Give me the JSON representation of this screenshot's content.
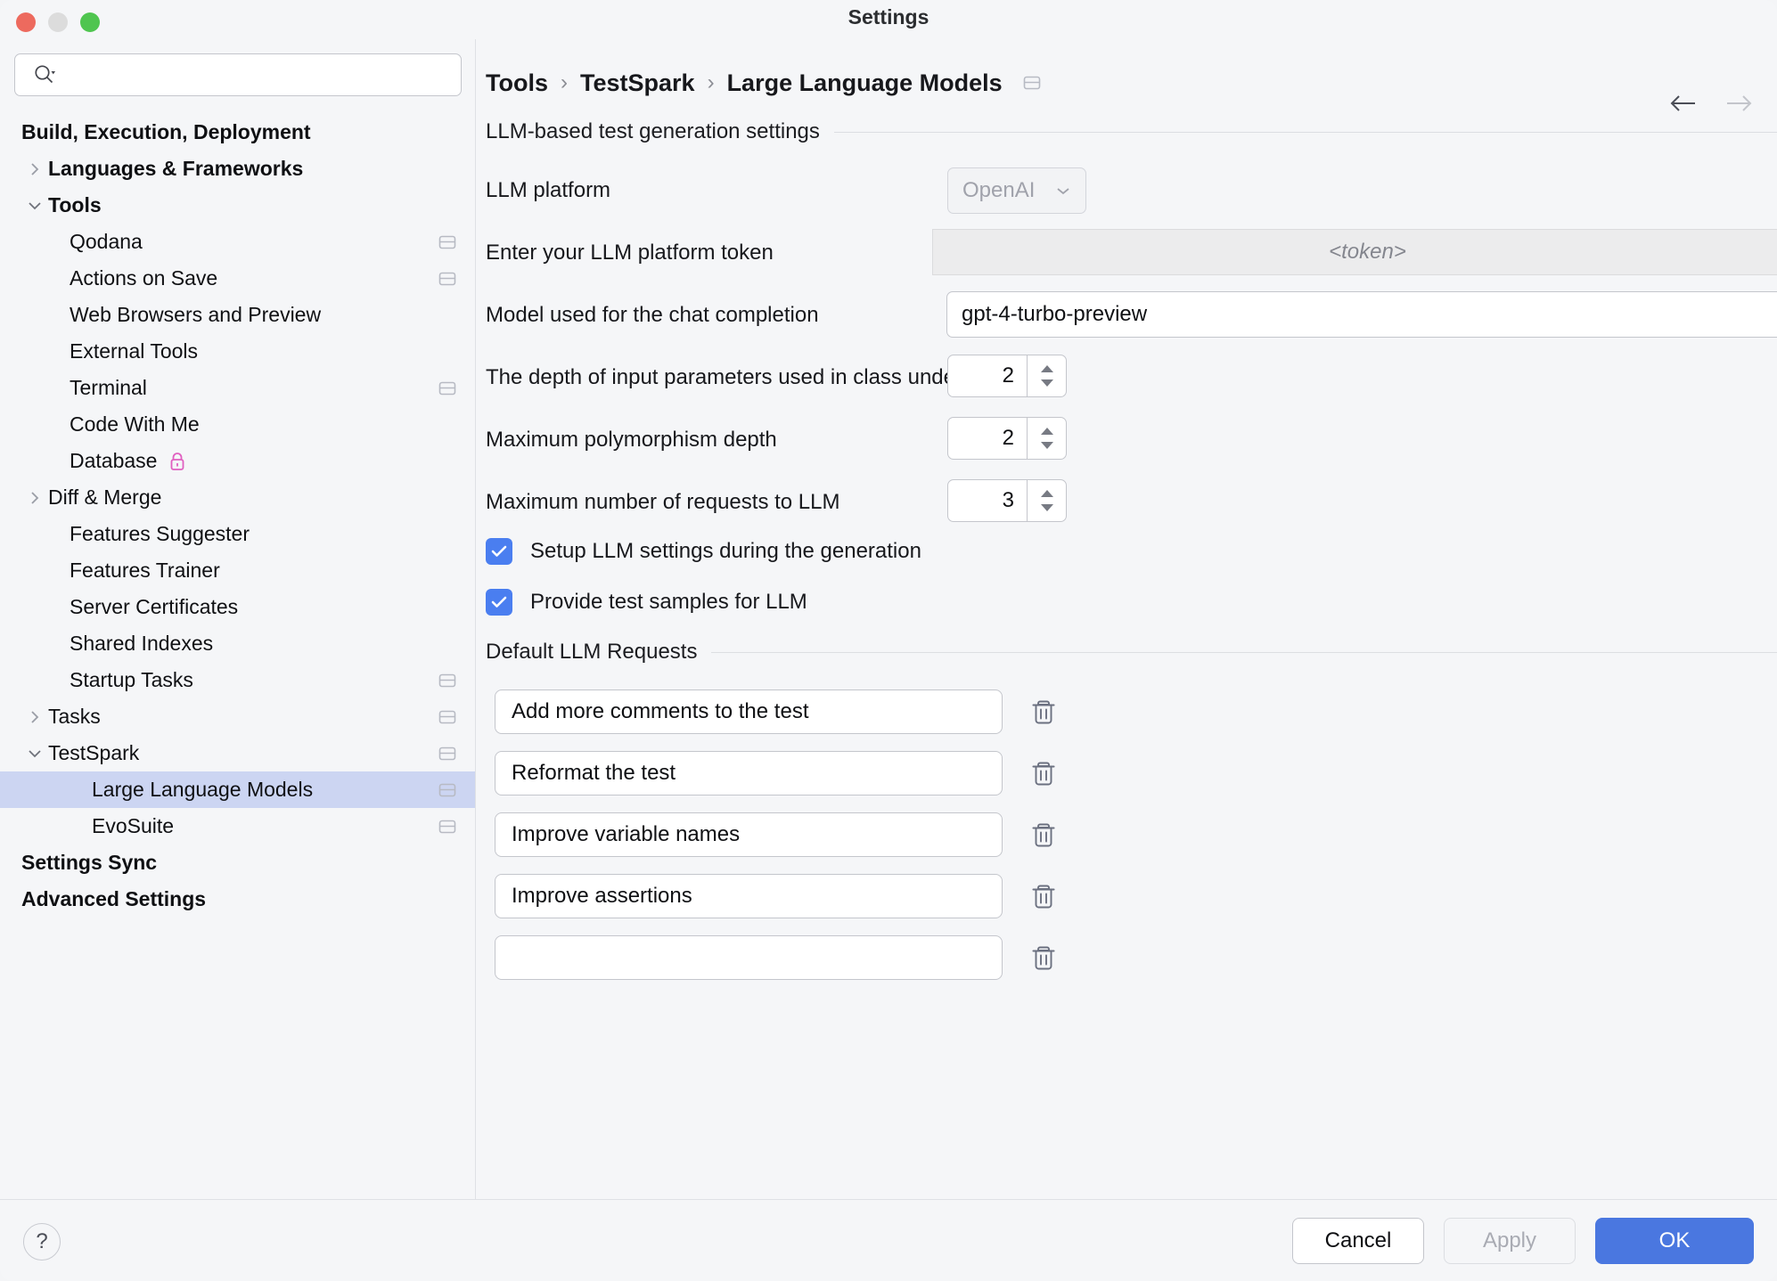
{
  "window": {
    "title": "Settings",
    "traffic_lights": [
      "close-button",
      "minimize-button",
      "zoom-button"
    ]
  },
  "sidebar": {
    "search": {
      "value": "",
      "placeholder": ""
    },
    "tree": [
      {
        "label": "Build, Execution, Deployment",
        "level": 0,
        "bold": true,
        "twisty": "none",
        "scope": false
      },
      {
        "label": "Languages & Frameworks",
        "level": 0,
        "bold": true,
        "twisty": "collapsed",
        "scope": false
      },
      {
        "label": "Tools",
        "level": 0,
        "bold": true,
        "twisty": "expanded",
        "scope": false
      },
      {
        "label": "Qodana",
        "level": 2,
        "bold": false,
        "twisty": "none",
        "scope": true
      },
      {
        "label": "Actions on Save",
        "level": 2,
        "bold": false,
        "twisty": "none",
        "scope": true
      },
      {
        "label": "Web Browsers and Preview",
        "level": 2,
        "bold": false,
        "twisty": "none",
        "scope": false
      },
      {
        "label": "External Tools",
        "level": 2,
        "bold": false,
        "twisty": "none",
        "scope": false
      },
      {
        "label": "Terminal",
        "level": 2,
        "bold": false,
        "twisty": "none",
        "scope": true
      },
      {
        "label": "Code With Me",
        "level": 2,
        "bold": false,
        "twisty": "none",
        "scope": false
      },
      {
        "label": "Database",
        "level": 2,
        "bold": false,
        "twisty": "none",
        "scope": false,
        "lock": true
      },
      {
        "label": "Diff & Merge",
        "level": 2,
        "bold": false,
        "twisty": "collapsed",
        "scope": false
      },
      {
        "label": "Features Suggester",
        "level": 2,
        "bold": false,
        "twisty": "none",
        "scope": false
      },
      {
        "label": "Features Trainer",
        "level": 2,
        "bold": false,
        "twisty": "none",
        "scope": false
      },
      {
        "label": "Server Certificates",
        "level": 2,
        "bold": false,
        "twisty": "none",
        "scope": false
      },
      {
        "label": "Shared Indexes",
        "level": 2,
        "bold": false,
        "twisty": "none",
        "scope": false
      },
      {
        "label": "Startup Tasks",
        "level": 2,
        "bold": false,
        "twisty": "none",
        "scope": true
      },
      {
        "label": "Tasks",
        "level": 2,
        "bold": false,
        "twisty": "collapsed",
        "scope": true
      },
      {
        "label": "TestSpark",
        "level": 2,
        "bold": false,
        "twisty": "expanded",
        "scope": true
      },
      {
        "label": "Large Language Models",
        "level": 3,
        "bold": false,
        "twisty": "none",
        "scope": true,
        "selected": true
      },
      {
        "label": "EvoSuite",
        "level": 3,
        "bold": false,
        "twisty": "none",
        "scope": true
      },
      {
        "label": "Settings Sync",
        "level": 0,
        "bold": true,
        "twisty": "none",
        "scope": false
      },
      {
        "label": "Advanced Settings",
        "level": 0,
        "bold": true,
        "twisty": "none",
        "scope": false
      }
    ]
  },
  "breadcrumb": {
    "items": [
      "Tools",
      "TestSpark",
      "Large Language Models"
    ],
    "separator": "›",
    "scope_icon": "project-scope-icon",
    "back_label": "back-arrow-icon",
    "forward_label": "forward-arrow-icon"
  },
  "main": {
    "group1_title": "LLM-based test generation settings",
    "group2_title": "Default LLM Requests",
    "fields": {
      "llm_platform_label": "LLM platform",
      "llm_platform_value": "OpenAI",
      "token_label": "Enter your LLM platform token",
      "token_placeholder": "<token>",
      "model_label": "Model used for the chat completion",
      "model_value": "gpt-4-turbo-preview",
      "depth_label": "The depth of input parameters used in class under tests",
      "depth_value": "2",
      "polymorphism_label": "Maximum polymorphism depth",
      "polymorphism_value": "2",
      "requests_label": "Maximum number of requests to LLM",
      "requests_value": "3"
    },
    "checkboxes": [
      {
        "label": "Setup LLM settings during the generation",
        "checked": true
      },
      {
        "label": "Provide test samples for LLM",
        "checked": true
      }
    ],
    "requests": [
      {
        "value": "Add more comments to the test",
        "delete_label": "delete-request-icon"
      },
      {
        "value": "Reformat the test",
        "delete_label": "delete-request-icon"
      },
      {
        "value": "Improve variable names",
        "delete_label": "delete-request-icon"
      },
      {
        "value": "Improve assertions",
        "delete_label": "delete-request-icon"
      },
      {
        "value": "",
        "delete_label": "delete-request-icon"
      }
    ]
  },
  "footer": {
    "help_label": "?",
    "cancel_label": "Cancel",
    "apply_label": "Apply",
    "ok_label": "OK"
  },
  "colors": {
    "accent_blue": "#4a77e0",
    "checkbox_blue": "#4a7ef0",
    "selection": "#ccd5f2",
    "background": "#f5f6f8",
    "lock_pink": "#e060c0"
  }
}
